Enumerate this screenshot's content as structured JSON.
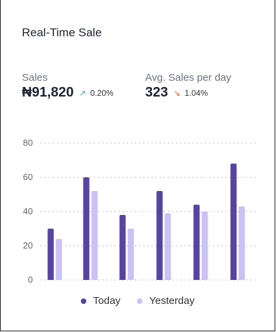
{
  "title": "Real-Time Sale",
  "metrics": {
    "sales": {
      "label": "Sales",
      "value": "₦91,820",
      "delta": "0.20%",
      "trend": "up",
      "arrow": "↗",
      "color": "#22b8a7"
    },
    "avg": {
      "label": "Avg. Sales per day",
      "value": "323",
      "delta": "1.04%",
      "trend": "down",
      "arrow": "↘",
      "color": "#f05a28"
    }
  },
  "legend": {
    "today": "Today",
    "yesterday": "Yesterday"
  },
  "colors": {
    "today": "#5743a1",
    "yesterday": "#c9c2f4",
    "grid": "#b8b8b8",
    "tick": "#666666"
  },
  "chart_data": {
    "type": "bar",
    "categories": [
      "",
      "",
      "",
      "",
      "",
      ""
    ],
    "series": [
      {
        "name": "Today",
        "values": [
          30,
          60,
          38,
          52,
          44,
          68
        ]
      },
      {
        "name": "Yesterday",
        "values": [
          24,
          52,
          30,
          39,
          40,
          43
        ]
      }
    ],
    "ylim": [
      0,
      80
    ],
    "yticks": [
      0,
      20,
      40,
      60,
      80
    ],
    "grid": true,
    "legend_position": "bottom"
  }
}
